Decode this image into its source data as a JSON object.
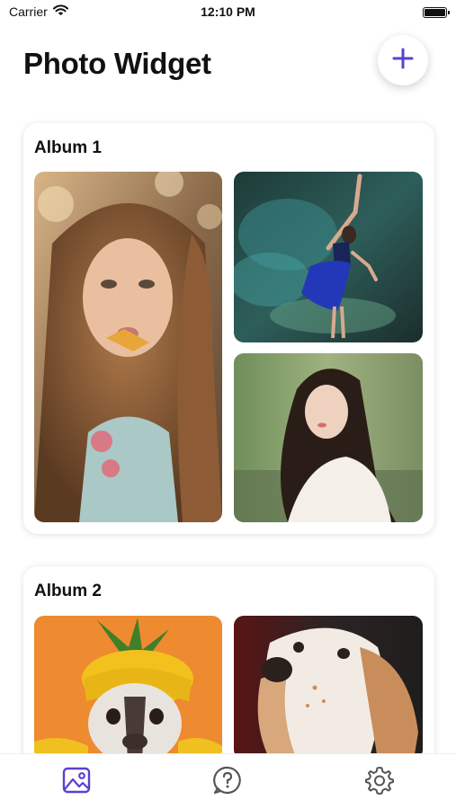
{
  "status_bar": {
    "carrier": "Carrier",
    "time": "12:10 PM"
  },
  "header": {
    "title": "Photo Widget",
    "add_icon": "plus-icon"
  },
  "albums": [
    {
      "title": "Album 1",
      "photos": [
        "woman-with-flower-photo",
        "dancer-blue-dress-photo",
        "woman-white-blouse-photo"
      ]
    },
    {
      "title": "Album 2",
      "photos": [
        "dog-pineapple-hat-photo",
        "spaniel-dog-photo"
      ]
    }
  ],
  "tab_bar": {
    "tabs": [
      "gallery-icon",
      "help-icon",
      "settings-icon"
    ],
    "active_color": "#5b3fd1",
    "inactive_color": "#555555"
  },
  "colors": {
    "accent": "#5b3fd1"
  }
}
